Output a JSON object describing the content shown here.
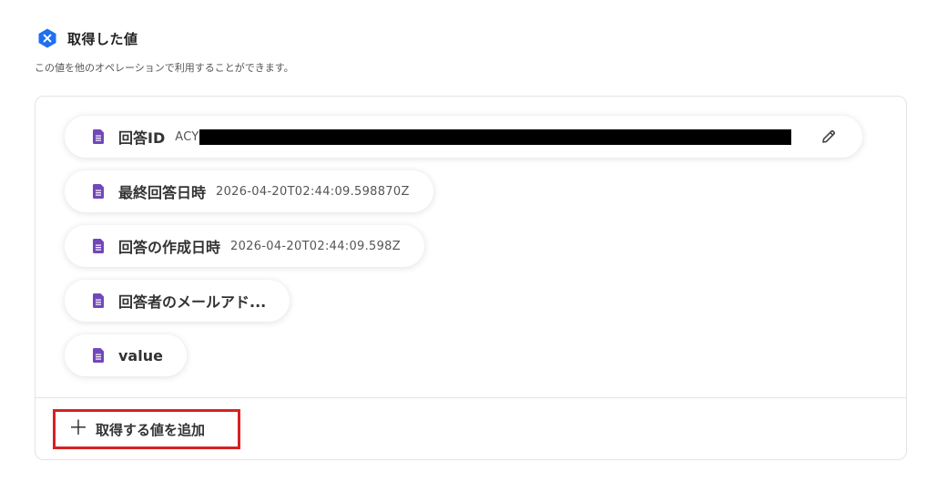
{
  "section": {
    "title": "取得した値",
    "description": "この値を他のオペレーションで利用することができます。",
    "icon": "blue-badge-x-icon",
    "accent_color": "#1e6ff2"
  },
  "fields": [
    {
      "label": "回答ID",
      "value": "ACY",
      "redacted": true,
      "editable": true,
      "icon": "form-doc-icon"
    },
    {
      "label": "最終回答日時",
      "value": "2026-04-20T02:44:09.598870Z",
      "icon": "form-doc-icon"
    },
    {
      "label": "回答の作成日時",
      "value": "2026-04-20T02:44:09.598Z",
      "icon": "form-doc-icon"
    },
    {
      "label": "回答者のメールアド...",
      "value": "",
      "icon": "form-doc-icon"
    },
    {
      "label": "value",
      "value": "",
      "icon": "form-doc-icon"
    }
  ],
  "field_icon_color": "#7248b9",
  "add_button": {
    "icon": "plus-icon",
    "label": "取得する値を追加",
    "highlight_color": "#d62222"
  }
}
